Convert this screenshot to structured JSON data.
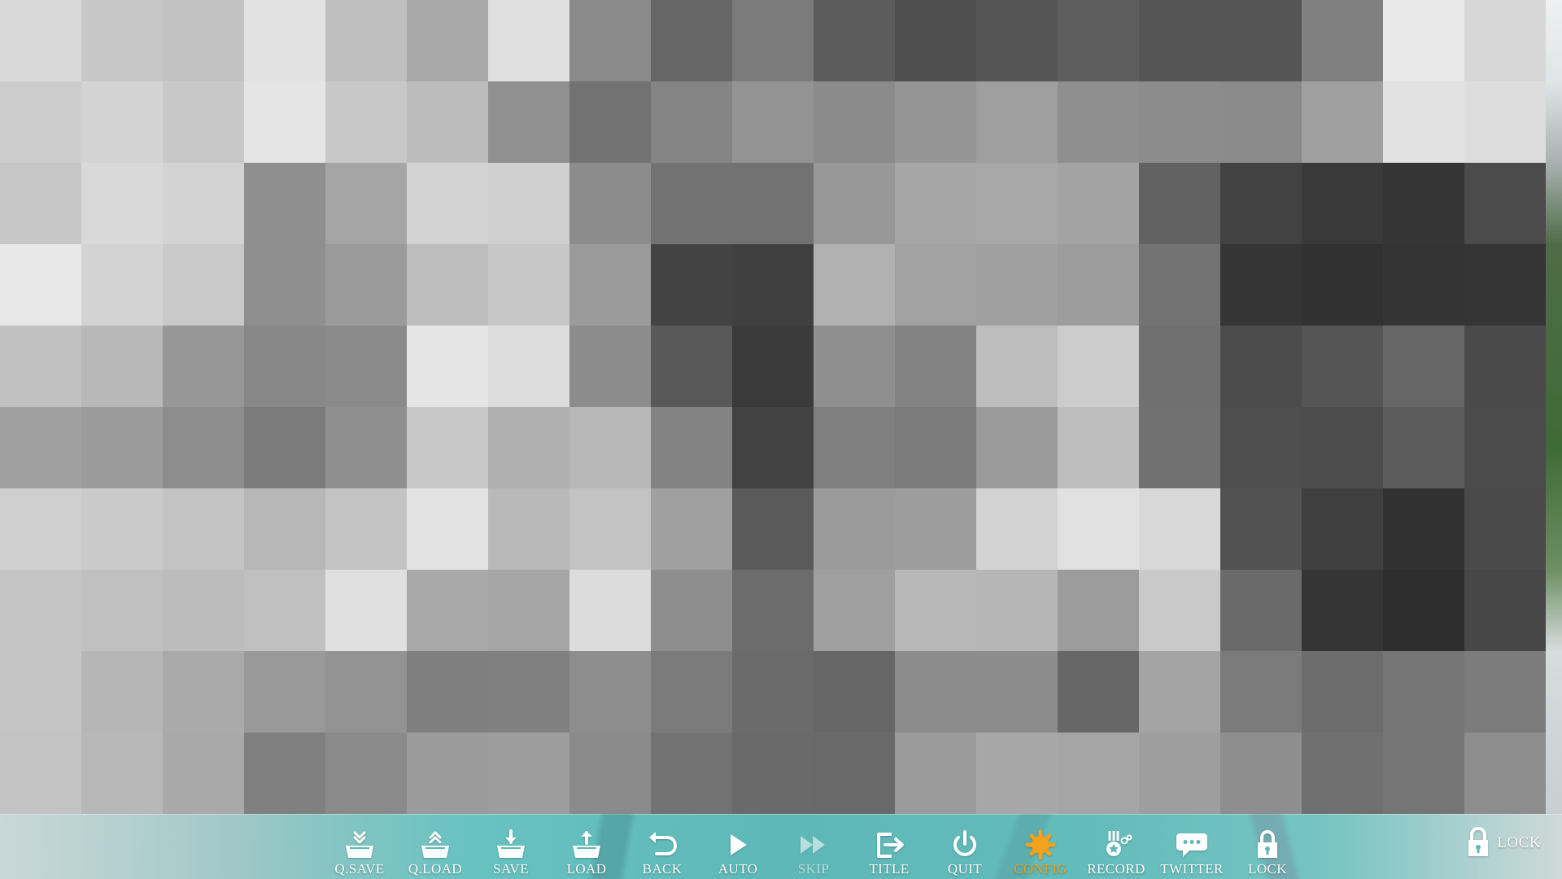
{
  "window": {
    "title": ""
  },
  "scene": {
    "mosaic_colors": [
      [
        "#d9d9d9",
        "#c7c7c7",
        "#c2c2c2",
        "#e2e2e2",
        "#bfbfbf",
        "#a8a8a8",
        "#e0e0e0",
        "#8a8a8a",
        "#666666",
        "#7b7b7b",
        "#5c5c5c",
        "#4f4f4f",
        "#545454",
        "#5d5d5d",
        "#555555",
        "#555555",
        "#808080",
        "#e9e9e9",
        "#d7d7d7"
      ],
      [
        "#cccccc",
        "#d3d3d3",
        "#c8c8c8",
        "#e5e5e5",
        "#c8c8c8",
        "#bcbcbc",
        "#909090",
        "#727272",
        "#848484",
        "#939393",
        "#8b8b8b",
        "#959595",
        "#9f9f9f",
        "#8f8f8f",
        "#8c8c8c",
        "#8a8a8a",
        "#a0a0a0",
        "#e2e2e2",
        "#dddddd"
      ],
      [
        "#c7c7c7",
        "#d9d9d9",
        "#d3d3d3",
        "#8f8f8f",
        "#a5a5a5",
        "#d3d3d3",
        "#cfcfcf",
        "#8c8c8c",
        "#727272",
        "#727272",
        "#989898",
        "#a6a6a6",
        "#a8a8a8",
        "#a3a3a3",
        "#626262",
        "#424242",
        "#3a3a3a",
        "#353535",
        "#4b4b4b"
      ],
      [
        "#e8e8e8",
        "#d3d3d3",
        "#c9c9c9",
        "#8f8f8f",
        "#9b9b9b",
        "#bdbdbd",
        "#c7c7c7",
        "#9b9b9b",
        "#434343",
        "#404040",
        "#b1b1b1",
        "#a2a2a2",
        "#a0a0a0",
        "#9c9c9c",
        "#727272",
        "#353535",
        "#313131",
        "#343434",
        "#353535"
      ],
      [
        "#c1c1c1",
        "#b8b8b8",
        "#979797",
        "#888888",
        "#8a8a8a",
        "#e5e5e5",
        "#dddddd",
        "#8c8c8c",
        "#595959",
        "#3b3b3b",
        "#8f8f8f",
        "#838383",
        "#bdbdbd",
        "#cccccc",
        "#707070",
        "#4c4c4c",
        "#555555",
        "#666666",
        "#4a4a4a"
      ],
      [
        "#a0a0a0",
        "#9b9b9b",
        "#8d8d8d",
        "#7b7b7b",
        "#8f8f8f",
        "#c8c8c8",
        "#b0b0b0",
        "#b8b8b8",
        "#838383",
        "#424242",
        "#808080",
        "#7b7b7b",
        "#9b9b9b",
        "#bdbdbd",
        "#717171",
        "#4e4e4e",
        "#4d4d4d",
        "#5c5c5c",
        "#4b4b4b"
      ],
      [
        "#cfcfcf",
        "#cacaca",
        "#c3c3c3",
        "#b7b7b7",
        "#c3c3c3",
        "#e3e3e3",
        "#b9b9b9",
        "#c3c3c3",
        "#a0a0a0",
        "#5a5a5a",
        "#9b9b9b",
        "#9d9d9d",
        "#d2d2d2",
        "#e1e1e1",
        "#d8d8d8",
        "#525252",
        "#3f3f3f",
        "#313131",
        "#4a4a4a"
      ],
      [
        "#c5c5c5",
        "#c0c0c0",
        "#bcbcbc",
        "#c0c0c0",
        "#e0e0e0",
        "#a8a8a8",
        "#a6a6a6",
        "#dcdcdc",
        "#8e8e8e",
        "#6c6c6c",
        "#a0a0a0",
        "#b7b7b7",
        "#b6b6b6",
        "#9c9c9c",
        "#c9c9c9",
        "#6a6a6a",
        "#353535",
        "#2e2e2e",
        "#474747"
      ],
      [
        "#c5c5c5",
        "#b6b6b6",
        "#aaaaaa",
        "#999999",
        "#939393",
        "#7f7f7f",
        "#808080",
        "#8d8d8d",
        "#7b7b7b",
        "#6b6b6b",
        "#666666",
        "#8c8c8c",
        "#8c8c8c",
        "#676767",
        "#a4a4a4",
        "#7b7b7b",
        "#6c6c6c",
        "#757575",
        "#7c7c7c"
      ],
      [
        "#c3c3c3",
        "#b8b8b8",
        "#a9a9a9",
        "#808080",
        "#8a8a8a",
        "#9b9b9b",
        "#9d9d9d",
        "#8a8a8a",
        "#727272",
        "#6a6a6a",
        "#696969",
        "#9b9b9b",
        "#a7a7a7",
        "#a5a5a5",
        "#9e9e9e",
        "#8e8e8e",
        "#707070",
        "#757575",
        "#8d8d8d"
      ]
    ],
    "toolbar": {
      "buttons": [
        {
          "id": "qsave",
          "label": "Q.SAVE",
          "icon": "quick-save-icon",
          "state": "normal"
        },
        {
          "id": "qload",
          "label": "Q.LOAD",
          "icon": "quick-load-icon",
          "state": "normal"
        },
        {
          "id": "save",
          "label": "SAVE",
          "icon": "save-icon",
          "state": "normal"
        },
        {
          "id": "load",
          "label": "LOAD",
          "icon": "load-icon",
          "state": "normal"
        },
        {
          "id": "back",
          "label": "BACK",
          "icon": "back-icon",
          "state": "normal"
        },
        {
          "id": "auto",
          "label": "AUTO",
          "icon": "play-icon",
          "state": "normal"
        },
        {
          "id": "skip",
          "label": "SKIP",
          "icon": "fast-forward-icon",
          "state": "dimmed"
        },
        {
          "id": "title",
          "label": "TITLE",
          "icon": "exit-to-title-icon",
          "state": "normal"
        },
        {
          "id": "quit",
          "label": "QUIT",
          "icon": "power-icon",
          "state": "normal"
        },
        {
          "id": "config",
          "label": "CONFIG",
          "icon": "gear-icon",
          "state": "active"
        },
        {
          "id": "record",
          "label": "RECORD",
          "icon": "medal-icon",
          "state": "normal"
        },
        {
          "id": "twitter",
          "label": "TWITTER",
          "icon": "speech-bubble-icon",
          "state": "normal"
        },
        {
          "id": "lock",
          "label": "LOCK",
          "icon": "lock-icon",
          "state": "normal"
        }
      ],
      "lock_corner_label": "LOCK"
    }
  },
  "colors": {
    "toolbar_text": "#ffffff",
    "active_text": "#f2a21b",
    "toolbar_teal": "#5eb8b7"
  }
}
